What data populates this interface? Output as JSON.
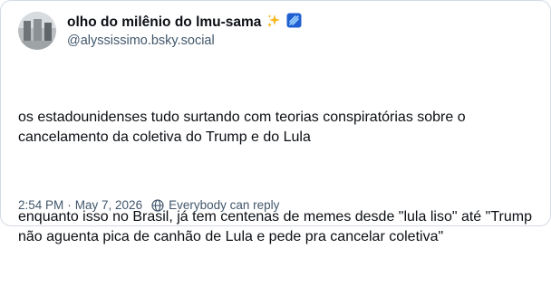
{
  "post": {
    "author": {
      "display_name": "olho do milênio do lmu-sama",
      "handle": "@alyssissimo.bsky.social",
      "name_icons": [
        "sparkles-icon",
        "blue-badge-icon"
      ]
    },
    "text_paragraphs": [
      "os estadounidenses tudo surtando com teorias conspiratórias sobre o cancelamento da coletiva do Trump e do Lula",
      "enquanto isso no Brasil, já tem centenas de memes desde \"lula liso\" até \"Trump não aguenta pica de canhão de Lula e pede pra cancelar coletiva\""
    ],
    "timestamp": "2:54 PM",
    "date": "May 7, 2026",
    "separator": "·",
    "reply_setting": "Everybody can reply"
  },
  "colors": {
    "text": "#0b0f14",
    "secondary_text": "#42576c",
    "border": "#d4dbe2",
    "sparkle": "#f5b81d",
    "badge": "#1f5fd1"
  }
}
